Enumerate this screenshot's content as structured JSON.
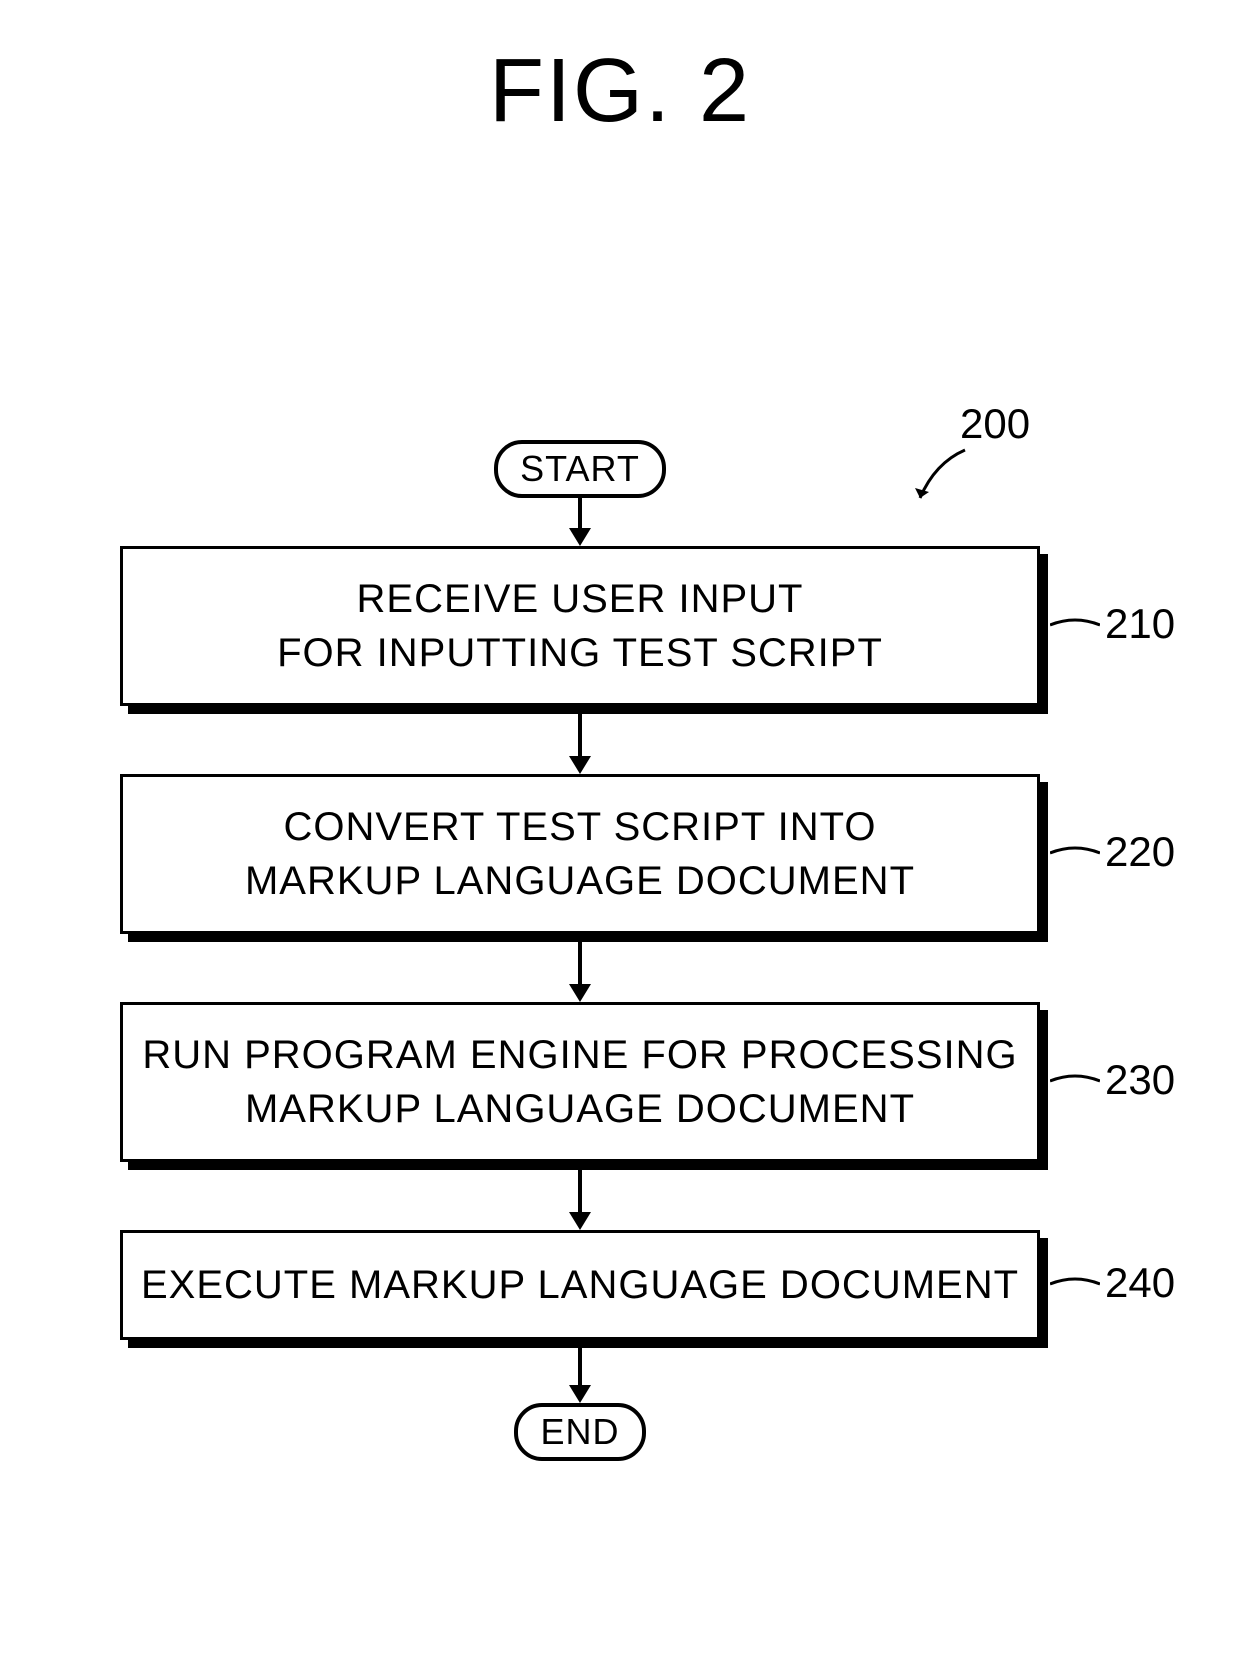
{
  "figure_title": "FIG. 2",
  "start_label": "START",
  "end_label": "END",
  "steps": [
    {
      "text": "RECEIVE USER INPUT\nFOR INPUTTING TEST SCRIPT",
      "ref": "210"
    },
    {
      "text": "CONVERT TEST SCRIPT INTO\nMARKUP LANGUAGE DOCUMENT",
      "ref": "220"
    },
    {
      "text": "RUN PROGRAM ENGINE FOR PROCESSING\nMARKUP LANGUAGE DOCUMENT",
      "ref": "230"
    },
    {
      "text": "EXECUTE MARKUP LANGUAGE DOCUMENT",
      "ref": "240"
    }
  ],
  "flow_ref": "200"
}
